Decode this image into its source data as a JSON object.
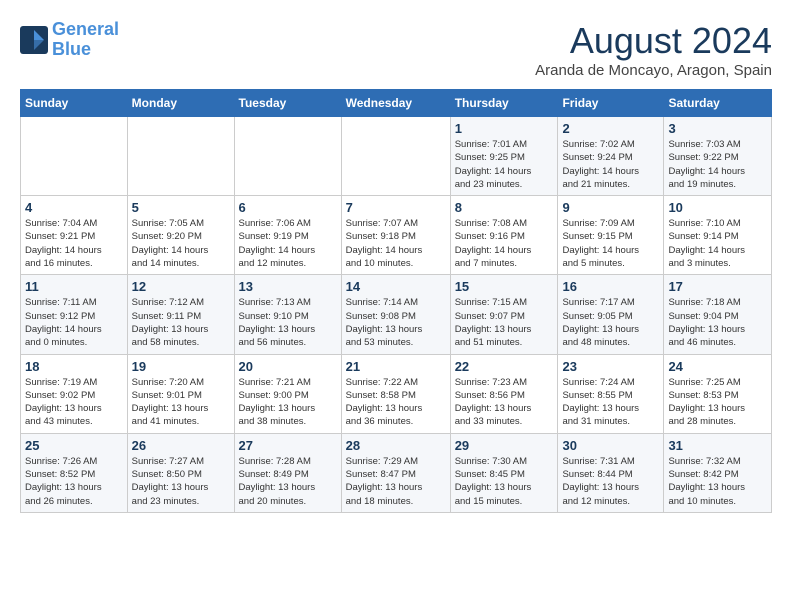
{
  "logo": {
    "line1": "General",
    "line2": "Blue"
  },
  "title": "August 2024",
  "location": "Aranda de Moncayo, Aragon, Spain",
  "weekdays": [
    "Sunday",
    "Monday",
    "Tuesday",
    "Wednesday",
    "Thursday",
    "Friday",
    "Saturday"
  ],
  "weeks": [
    [
      {
        "day": "",
        "info": ""
      },
      {
        "day": "",
        "info": ""
      },
      {
        "day": "",
        "info": ""
      },
      {
        "day": "",
        "info": ""
      },
      {
        "day": "1",
        "info": "Sunrise: 7:01 AM\nSunset: 9:25 PM\nDaylight: 14 hours\nand 23 minutes."
      },
      {
        "day": "2",
        "info": "Sunrise: 7:02 AM\nSunset: 9:24 PM\nDaylight: 14 hours\nand 21 minutes."
      },
      {
        "day": "3",
        "info": "Sunrise: 7:03 AM\nSunset: 9:22 PM\nDaylight: 14 hours\nand 19 minutes."
      }
    ],
    [
      {
        "day": "4",
        "info": "Sunrise: 7:04 AM\nSunset: 9:21 PM\nDaylight: 14 hours\nand 16 minutes."
      },
      {
        "day": "5",
        "info": "Sunrise: 7:05 AM\nSunset: 9:20 PM\nDaylight: 14 hours\nand 14 minutes."
      },
      {
        "day": "6",
        "info": "Sunrise: 7:06 AM\nSunset: 9:19 PM\nDaylight: 14 hours\nand 12 minutes."
      },
      {
        "day": "7",
        "info": "Sunrise: 7:07 AM\nSunset: 9:18 PM\nDaylight: 14 hours\nand 10 minutes."
      },
      {
        "day": "8",
        "info": "Sunrise: 7:08 AM\nSunset: 9:16 PM\nDaylight: 14 hours\nand 7 minutes."
      },
      {
        "day": "9",
        "info": "Sunrise: 7:09 AM\nSunset: 9:15 PM\nDaylight: 14 hours\nand 5 minutes."
      },
      {
        "day": "10",
        "info": "Sunrise: 7:10 AM\nSunset: 9:14 PM\nDaylight: 14 hours\nand 3 minutes."
      }
    ],
    [
      {
        "day": "11",
        "info": "Sunrise: 7:11 AM\nSunset: 9:12 PM\nDaylight: 14 hours\nand 0 minutes."
      },
      {
        "day": "12",
        "info": "Sunrise: 7:12 AM\nSunset: 9:11 PM\nDaylight: 13 hours\nand 58 minutes."
      },
      {
        "day": "13",
        "info": "Sunrise: 7:13 AM\nSunset: 9:10 PM\nDaylight: 13 hours\nand 56 minutes."
      },
      {
        "day": "14",
        "info": "Sunrise: 7:14 AM\nSunset: 9:08 PM\nDaylight: 13 hours\nand 53 minutes."
      },
      {
        "day": "15",
        "info": "Sunrise: 7:15 AM\nSunset: 9:07 PM\nDaylight: 13 hours\nand 51 minutes."
      },
      {
        "day": "16",
        "info": "Sunrise: 7:17 AM\nSunset: 9:05 PM\nDaylight: 13 hours\nand 48 minutes."
      },
      {
        "day": "17",
        "info": "Sunrise: 7:18 AM\nSunset: 9:04 PM\nDaylight: 13 hours\nand 46 minutes."
      }
    ],
    [
      {
        "day": "18",
        "info": "Sunrise: 7:19 AM\nSunset: 9:02 PM\nDaylight: 13 hours\nand 43 minutes."
      },
      {
        "day": "19",
        "info": "Sunrise: 7:20 AM\nSunset: 9:01 PM\nDaylight: 13 hours\nand 41 minutes."
      },
      {
        "day": "20",
        "info": "Sunrise: 7:21 AM\nSunset: 9:00 PM\nDaylight: 13 hours\nand 38 minutes."
      },
      {
        "day": "21",
        "info": "Sunrise: 7:22 AM\nSunset: 8:58 PM\nDaylight: 13 hours\nand 36 minutes."
      },
      {
        "day": "22",
        "info": "Sunrise: 7:23 AM\nSunset: 8:56 PM\nDaylight: 13 hours\nand 33 minutes."
      },
      {
        "day": "23",
        "info": "Sunrise: 7:24 AM\nSunset: 8:55 PM\nDaylight: 13 hours\nand 31 minutes."
      },
      {
        "day": "24",
        "info": "Sunrise: 7:25 AM\nSunset: 8:53 PM\nDaylight: 13 hours\nand 28 minutes."
      }
    ],
    [
      {
        "day": "25",
        "info": "Sunrise: 7:26 AM\nSunset: 8:52 PM\nDaylight: 13 hours\nand 26 minutes."
      },
      {
        "day": "26",
        "info": "Sunrise: 7:27 AM\nSunset: 8:50 PM\nDaylight: 13 hours\nand 23 minutes."
      },
      {
        "day": "27",
        "info": "Sunrise: 7:28 AM\nSunset: 8:49 PM\nDaylight: 13 hours\nand 20 minutes."
      },
      {
        "day": "28",
        "info": "Sunrise: 7:29 AM\nSunset: 8:47 PM\nDaylight: 13 hours\nand 18 minutes."
      },
      {
        "day": "29",
        "info": "Sunrise: 7:30 AM\nSunset: 8:45 PM\nDaylight: 13 hours\nand 15 minutes."
      },
      {
        "day": "30",
        "info": "Sunrise: 7:31 AM\nSunset: 8:44 PM\nDaylight: 13 hours\nand 12 minutes."
      },
      {
        "day": "31",
        "info": "Sunrise: 7:32 AM\nSunset: 8:42 PM\nDaylight: 13 hours\nand 10 minutes."
      }
    ]
  ]
}
